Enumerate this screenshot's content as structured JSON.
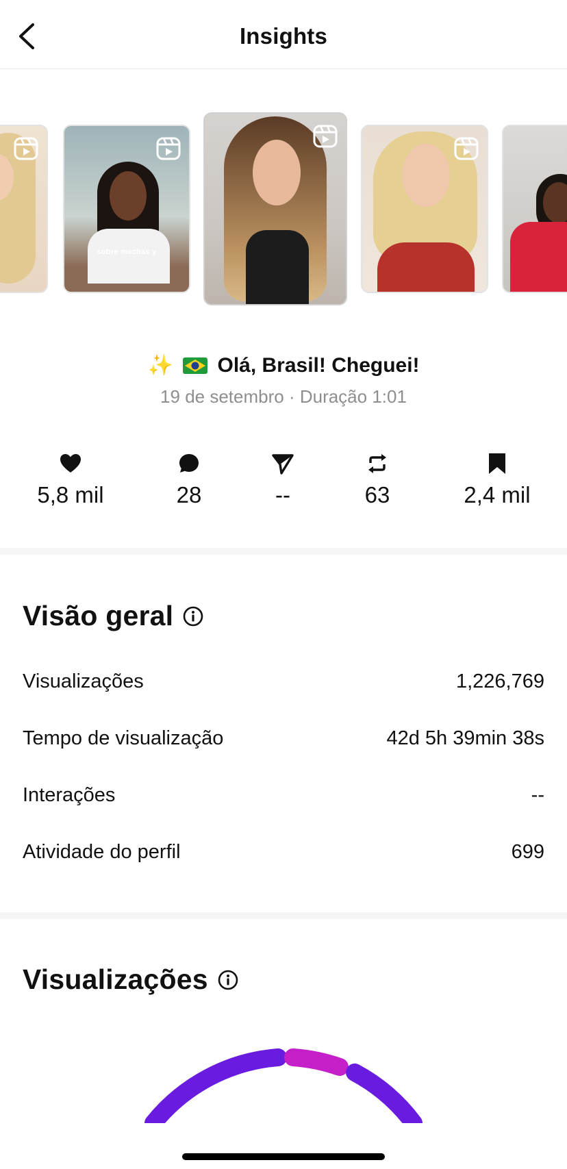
{
  "header": {
    "title": "Insights",
    "back_icon": "chevron-left-icon"
  },
  "carousel": {
    "reel_icon": "reels-icon",
    "items": [
      {
        "caption": ""
      },
      {
        "caption": "sobre mechas y"
      },
      {
        "caption": ""
      },
      {
        "caption": ""
      },
      {
        "caption": ""
      }
    ]
  },
  "post": {
    "title": "Olá, Brasil! Cheguei!",
    "title_prefix": "✨",
    "flag_icon": "brazil-flag-icon",
    "date": "19 de setembro",
    "separator": " · ",
    "duration": "Duração 1:01"
  },
  "stats": [
    {
      "icon": "heart-icon",
      "value": "5,8 mil"
    },
    {
      "icon": "comment-icon",
      "value": "28"
    },
    {
      "icon": "share-icon",
      "value": "--"
    },
    {
      "icon": "repost-icon",
      "value": "63"
    },
    {
      "icon": "bookmark-icon",
      "value": "2,4 mil"
    }
  ],
  "overview": {
    "title": "Visão geral",
    "rows": [
      {
        "label": "Visualizações",
        "value": "1,226,769"
      },
      {
        "label": "Tempo de visualização",
        "value": "42d 5h 39min 38s"
      },
      {
        "label": "Interações",
        "value": "--"
      },
      {
        "label": "Atividade do perfil",
        "value": "699"
      }
    ]
  },
  "views": {
    "title": "Visualizações",
    "gauge_colors": {
      "primary": "#6a1be0",
      "secondary": "#c41fc9"
    }
  },
  "colors": {
    "divider": "#f5f5f5",
    "muted_text": "#8e8e8e"
  }
}
